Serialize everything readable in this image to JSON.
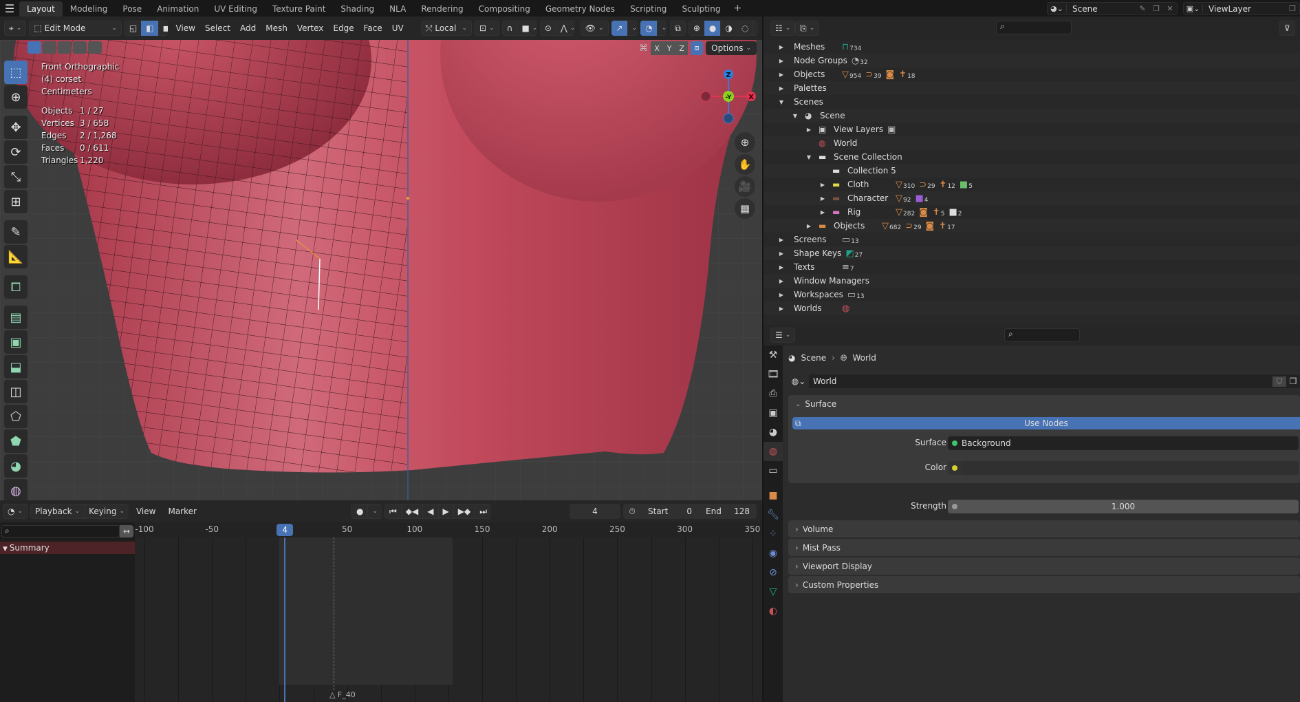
{
  "topbar": {
    "menu_icon": "hamburger-icon",
    "workspaces": [
      "Layout",
      "Modeling",
      "Pose",
      "Animation",
      "UV Editing",
      "Texture Paint",
      "Shading",
      "NLA",
      "Rendering",
      "Compositing",
      "Geometry Nodes",
      "Scripting",
      "Sculpting"
    ],
    "active_workspace": "Layout",
    "add_tab": "+",
    "scene": {
      "icon": "scene-icon",
      "name": "Scene"
    },
    "view_layer": {
      "icon": "view-layer-icon",
      "name": "ViewLayer"
    }
  },
  "viewport": {
    "header": {
      "mode": "Edit Mode",
      "menus": [
        "View",
        "Select",
        "Add",
        "Mesh",
        "Vertex",
        "Edge",
        "Face",
        "UV"
      ],
      "select_modes": [
        "vertex",
        "edge",
        "face"
      ],
      "active_select_mode": "edge",
      "transform_orientation": "Local",
      "options_label": "Options",
      "axes": [
        "X",
        "Y",
        "Z"
      ]
    },
    "overlay": {
      "view_name": "Front Orthographic",
      "object_name": "(4) corset",
      "units": "Centimeters",
      "stats": [
        {
          "label": "Objects",
          "value": "1 / 27"
        },
        {
          "label": "Vertices",
          "value": "3 / 658"
        },
        {
          "label": "Edges",
          "value": "2 / 1,268"
        },
        {
          "label": "Faces",
          "value": "0 / 611"
        },
        {
          "label": "Triangles",
          "value": "1,220"
        }
      ]
    },
    "gizmo": {
      "z": "Z",
      "y": "-Y",
      "x": "X"
    },
    "colors": {
      "mesh": "#c44a5c",
      "x_axis": "#e0334f",
      "y_axis": "#8bd41e",
      "z_axis": "#2f7fdd",
      "accent": "#4772b3"
    }
  },
  "timeline": {
    "header": {
      "menus": [
        "Playback",
        "Keying",
        "View",
        "Marker"
      ],
      "current_frame": "4",
      "start_label": "Start",
      "start_value": "0",
      "end_label": "End",
      "end_value": "128"
    },
    "summary_label": "Summary",
    "ruler_ticks": [
      "-100",
      "-50",
      "50",
      "100",
      "150",
      "200",
      "250",
      "300",
      "350"
    ],
    "playhead": "4",
    "marker": "F_40"
  },
  "outliner": {
    "rows": [
      {
        "label": "Meshes",
        "indent": 0,
        "expand": "closed",
        "badges": [
          {
            "icon": "mesh-data-icon",
            "count": "734",
            "color": "#1fa386"
          }
        ]
      },
      {
        "label": "Node Groups",
        "indent": 0,
        "expand": "closed",
        "badges": [
          {
            "icon": "node-group-icon",
            "count": "32",
            "color": "#bbbbbb"
          }
        ]
      },
      {
        "label": "Objects",
        "indent": 0,
        "expand": "closed",
        "badges": [
          {
            "icon": "mesh-object-icon",
            "count": "954",
            "color": "#d98a47"
          },
          {
            "icon": "curve-icon",
            "count": "39",
            "color": "#d98a47"
          },
          {
            "icon": "camera-icon",
            "count": "",
            "color": "#d98a47"
          },
          {
            "icon": "armature-icon",
            "count": "18",
            "color": "#d98a47"
          }
        ]
      },
      {
        "label": "Palettes",
        "indent": 0,
        "expand": "closed",
        "badges": []
      },
      {
        "label": "Scenes",
        "indent": 0,
        "expand": "open",
        "badges": []
      },
      {
        "label": "Scene",
        "indent": 1,
        "expand": "open",
        "icon": "scene-icon",
        "badges": []
      },
      {
        "label": "View Layers",
        "indent": 2,
        "expand": "closed",
        "icon": "view-layer-icon",
        "badges": [
          {
            "icon": "view-layer-icon",
            "count": "",
            "color": "#bbbbbb"
          }
        ]
      },
      {
        "label": "World",
        "indent": 2,
        "expand": "none",
        "icon": "world-icon",
        "badges": []
      },
      {
        "label": "Scene Collection",
        "indent": 2,
        "expand": "open",
        "icon": "collection-icon",
        "badges": []
      },
      {
        "label": "Collection 5",
        "indent": 3,
        "expand": "none",
        "icon": "collection-icon",
        "badges": []
      },
      {
        "label": "Cloth",
        "indent": 3,
        "expand": "closed",
        "icon": "collection-yellow-icon",
        "badges": [
          {
            "icon": "mesh-object-icon",
            "count": "310",
            "color": "#d98a47"
          },
          {
            "icon": "curve-icon",
            "count": "29",
            "color": "#d98a47"
          },
          {
            "icon": "armature-icon",
            "count": "12",
            "color": "#d98a47"
          },
          {
            "icon": "collection-green-icon",
            "count": "5",
            "color": "#6bbf6b"
          }
        ]
      },
      {
        "label": "Character",
        "indent": 3,
        "expand": "closed",
        "icon": "collection-brown-icon",
        "badges": [
          {
            "icon": "mesh-object-icon",
            "count": "92",
            "color": "#d98a47"
          },
          {
            "icon": "collection-purple-icon",
            "count": "4",
            "color": "#9a5dd6"
          }
        ]
      },
      {
        "label": "Rig",
        "indent": 3,
        "expand": "closed",
        "icon": "collection-pink-icon",
        "badges": [
          {
            "icon": "mesh-object-icon",
            "count": "282",
            "color": "#d98a47"
          },
          {
            "icon": "camera-icon",
            "count": "",
            "color": "#d98a47"
          },
          {
            "icon": "armature-icon",
            "count": "5",
            "color": "#d98a47"
          },
          {
            "icon": "collection-icon",
            "count": "2",
            "color": "#dddddd"
          }
        ]
      },
      {
        "label": "Objects",
        "indent": 2,
        "expand": "closed",
        "icon": "collection-orange-icon",
        "badges": [
          {
            "icon": "mesh-object-icon",
            "count": "682",
            "color": "#d98a47"
          },
          {
            "icon": "curve-icon",
            "count": "29",
            "color": "#d98a47"
          },
          {
            "icon": "camera-icon",
            "count": "",
            "color": "#d98a47"
          },
          {
            "icon": "armature-icon",
            "count": "17",
            "color": "#d98a47"
          }
        ]
      },
      {
        "label": "Screens",
        "indent": 0,
        "expand": "closed",
        "badges": [
          {
            "icon": "screen-icon",
            "count": "13",
            "color": "#bbbbbb"
          }
        ]
      },
      {
        "label": "Shape Keys",
        "indent": 0,
        "expand": "closed",
        "badges": [
          {
            "icon": "shape-key-icon",
            "count": "27",
            "color": "#1fa386"
          }
        ]
      },
      {
        "label": "Texts",
        "indent": 0,
        "expand": "closed",
        "badges": [
          {
            "icon": "text-icon",
            "count": "7",
            "color": "#bbbbbb"
          }
        ]
      },
      {
        "label": "Window Managers",
        "indent": 0,
        "expand": "closed",
        "badges": []
      },
      {
        "label": "Workspaces",
        "indent": 0,
        "expand": "closed",
        "badges": [
          {
            "icon": "workspace-icon",
            "count": "13",
            "color": "#bbbbbb"
          }
        ]
      },
      {
        "label": "Worlds",
        "indent": 0,
        "expand": "closed",
        "badges": [
          {
            "icon": "world-icon",
            "count": "",
            "color": "#c9525c"
          }
        ]
      }
    ]
  },
  "properties": {
    "breadcrumb": [
      "Scene",
      "World"
    ],
    "datablock": "World",
    "surface_panel": {
      "title": "Surface",
      "use_nodes_label": "Use Nodes",
      "surface_label": "Surface",
      "surface_value": "Background",
      "color_label": "Color",
      "strength_label": "Strength",
      "strength_value": "1.000"
    },
    "collapsed_panels": [
      "Volume",
      "Mist Pass",
      "Viewport Display",
      "Custom Properties"
    ],
    "tabs": [
      "tool",
      "render",
      "output",
      "view-layer",
      "scene",
      "world",
      "collection",
      "object",
      "modifiers",
      "particles",
      "physics",
      "constraints",
      "data",
      "material"
    ],
    "active_tab": "world"
  }
}
